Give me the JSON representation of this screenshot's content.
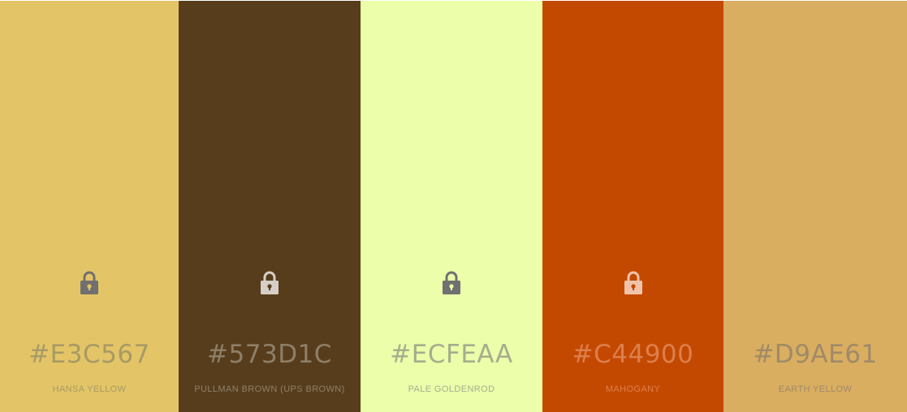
{
  "swatches": [
    {
      "hex": "#E3C567",
      "name": "HANSA YELLOW",
      "background": "#E3C567",
      "text_color": "#A89A65",
      "lock_color": "#707070",
      "lock_hole_color": "#E3C567",
      "icon": "lock-icon"
    },
    {
      "hex": "#573D1C",
      "name": "PULLMAN BROWN (UPS BROWN)",
      "background": "#573D1C",
      "text_color": "#8E7F68",
      "lock_color": "#D6CFC7",
      "lock_hole_color": "#573D1C",
      "icon": "lock-icon"
    },
    {
      "hex": "#ECFEAA",
      "name": "PALE GOLDENROD",
      "background": "#ECFEAA",
      "text_color": "#A6AD8C",
      "lock_color": "#707070",
      "lock_hole_color": "#ECFEAA",
      "icon": "lock-icon"
    },
    {
      "hex": "#C44900",
      "name": "MAHOGANY",
      "background": "#C44900",
      "text_color": "#DC7F4C",
      "lock_color": "#F0C4AA",
      "lock_hole_color": "#C44900",
      "icon": "lock-icon"
    },
    {
      "hex": "#D9AE61",
      "name": "EARTH YELLOW",
      "background": "#D9AE61",
      "text_color": "#A08A66",
      "lock_color": null,
      "lock_hole_color": null,
      "icon": null
    }
  ]
}
